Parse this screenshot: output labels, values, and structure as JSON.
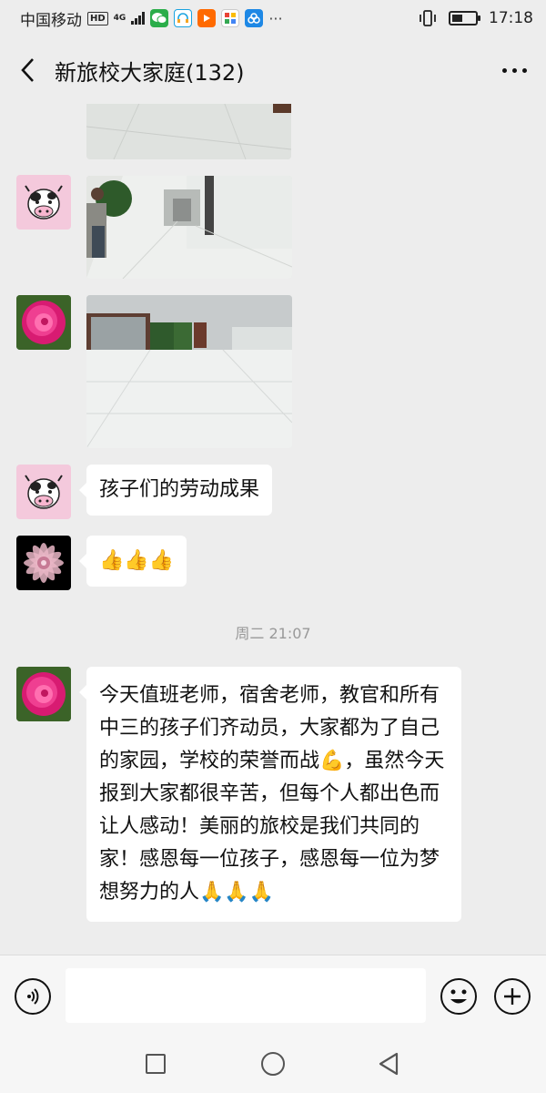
{
  "status_bar": {
    "carrier": "中国移动",
    "hd_badge": "HD",
    "network_type": "4G",
    "network_sub": "+",
    "time": "17:18",
    "battery_level": 0.45,
    "app_icons": [
      "wechat-icon",
      "headset-app-icon",
      "video-app-icon",
      "taobao-app-icon",
      "map-app-icon"
    ],
    "overflow": "···"
  },
  "header": {
    "title": "新旅校大家庭(132)"
  },
  "chat": {
    "messages": [
      {
        "type": "image",
        "avatar": "cow-avatar",
        "description": "hallway photo"
      },
      {
        "type": "image",
        "avatar": "cow-avatar"
      },
      {
        "type": "image",
        "avatar": "peony-avatar"
      },
      {
        "type": "text",
        "avatar": "cow-avatar",
        "text": "孩子们的劳动成果"
      },
      {
        "type": "emoji",
        "avatar": "mandala-avatar",
        "text": "👍👍👍"
      },
      {
        "type": "text",
        "avatar": "peony-avatar",
        "text": "今天值班老师，宿舍老师，教官和所有中三的孩子们齐动员，大家都为了自己的家园，学校的荣誉而战💪，虽然今天报到大家都很辛苦，但每个人都出色而让人感动！美丽的旅校是我们共同的家！感恩每一位孩子，感恩每一位为梦想努力的人🙏🙏🙏"
      }
    ],
    "timestamp": "周二 21:07"
  },
  "input_bar": {
    "placeholder": ""
  },
  "colors": {
    "background": "#ededed",
    "bubble": "#ffffff",
    "timestamp_text": "#999999"
  }
}
